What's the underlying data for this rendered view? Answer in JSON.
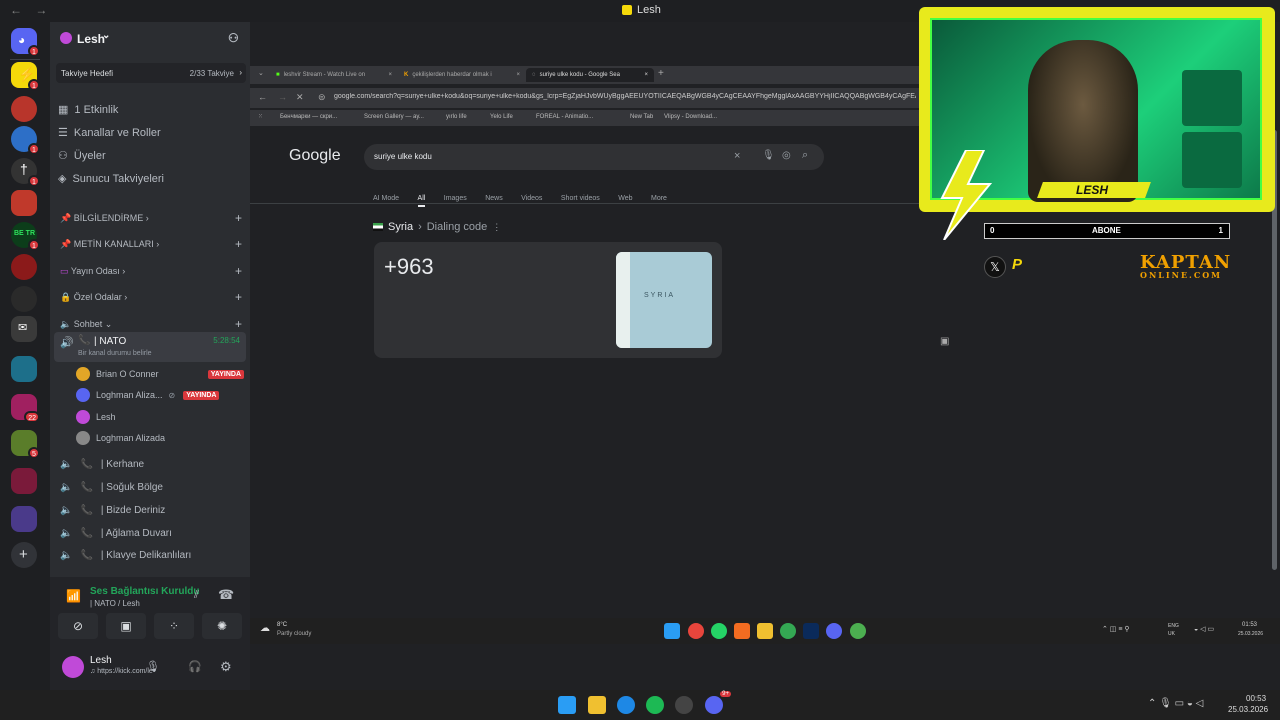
{
  "window": {
    "title": "Lesh",
    "back_arrow": "←",
    "forward_arrow": "→"
  },
  "rail": {
    "badges": [
      "1",
      "1",
      "1",
      "1",
      "1",
      "1",
      "22",
      "5"
    ],
    "add_server": "+"
  },
  "guild": {
    "name": "Lesh",
    "boost_label": "Takviye Hedefi",
    "boost_count": "2/33 Takviye"
  },
  "sidebar_items": [
    {
      "label": "1 Etkinlik",
      "icon": "calendar-icon"
    },
    {
      "label": "Kanallar ve Roller",
      "icon": "list-icon"
    },
    {
      "label": "Üyeler",
      "icon": "members-icon"
    },
    {
      "label": "Sunucu Takviyeleri",
      "icon": "boost-icon"
    }
  ],
  "categories": [
    {
      "label": "BİLGİLENDİRME"
    },
    {
      "label": "METİN KANALLARI"
    },
    {
      "label": "Yayın Odası"
    },
    {
      "label": "Özel Odalar"
    },
    {
      "label": "Sohbet"
    }
  ],
  "active_voice": {
    "name": "| NATO",
    "timer": "5:28:54",
    "status": "Bir kanal durumu belirle"
  },
  "members": [
    {
      "name": "Brian O Conner",
      "live": "YAYINDA",
      "color": "#e2a627"
    },
    {
      "name": "Loghman Aliza...",
      "live": "YAYINDA",
      "color": "#5865f2"
    },
    {
      "name": "Lesh",
      "live": "",
      "color": "#c04ad8"
    },
    {
      "name": "Loghman Alizada",
      "live": "",
      "color": "#888888"
    }
  ],
  "voice_channels": [
    "| Kerhane",
    "| Soğuk Bölge",
    "| Bizde Deriniz",
    "| Ağlama Duvarı",
    "| Klavye Delikanlıları"
  ],
  "voice_panel": {
    "status": "Ses Bağlantısı Kuruldu",
    "channel": "| NATO / Lesh"
  },
  "user_panel": {
    "name": "Lesh",
    "status": "♫ https://kick.com/le"
  },
  "browser": {
    "tabs": [
      {
        "label": "leshvir Stream - Watch Live on",
        "active": false
      },
      {
        "label": "çekilişlerden haberdar olmak i",
        "active": false
      },
      {
        "label": "suriye ulke kodu - Google Sea",
        "active": true
      }
    ],
    "new_tab": "+",
    "url": "google.com/search?q=suriye+ulke+kodu&oq=suriye+ulke+kodu&gs_lcrp=EgZjaHJvbWUyBggAEEUYOTIICAEQABgWGB4yCAgCEAAYFhgeMgglAxAAGBYYHjIICAQQABgWGB4yCAgFEAAYFhgeMgglBhAAGBYYHjIICAcQABgWGB4yCAgIEAAYFhge",
    "bookmarks": [
      "Бенчмарки — скри...",
      "Screen Gallery — ay...",
      "yırlo life",
      "Yelo Life",
      "FOREAL - Animatio...",
      "New Tab",
      "Vlipsy - Download..."
    ]
  },
  "google": {
    "logo": "Google",
    "query": "suriye ulke kodu",
    "tabs": [
      "AI Mode",
      "All",
      "Images",
      "News",
      "Videos",
      "Short videos",
      "Web",
      "More"
    ],
    "active_tab": "All",
    "breadcrumb_country": "Syria",
    "breadcrumb_sep": "›",
    "breadcrumb_label": "Dialing code",
    "answer": "+963",
    "map_label": "SYRIA"
  },
  "inner_taskbar": {
    "weather_temp": "8°C",
    "weather_desc": "Partly cloudy",
    "lang": "ENG",
    "lang_sub": "UK",
    "time": "01:53",
    "date": "25.03.2026"
  },
  "overlay": {
    "name": "LESH",
    "abone_left": "0",
    "abone_label": "ABONE",
    "abone_right": "1",
    "brand_top": "KAPTAN",
    "brand_bottom": "ONLINE.COM",
    "x_icon": "𝕏",
    "p_icon": "P"
  },
  "taskbar": {
    "time": "00:53",
    "date": "25.03.2026",
    "discord_badge": "9+"
  },
  "colors": {
    "discord_bg": "#2b2d31",
    "live_red": "#da373c",
    "voice_green": "#23a55a",
    "overlay_yellow": "#e8ea1c"
  }
}
